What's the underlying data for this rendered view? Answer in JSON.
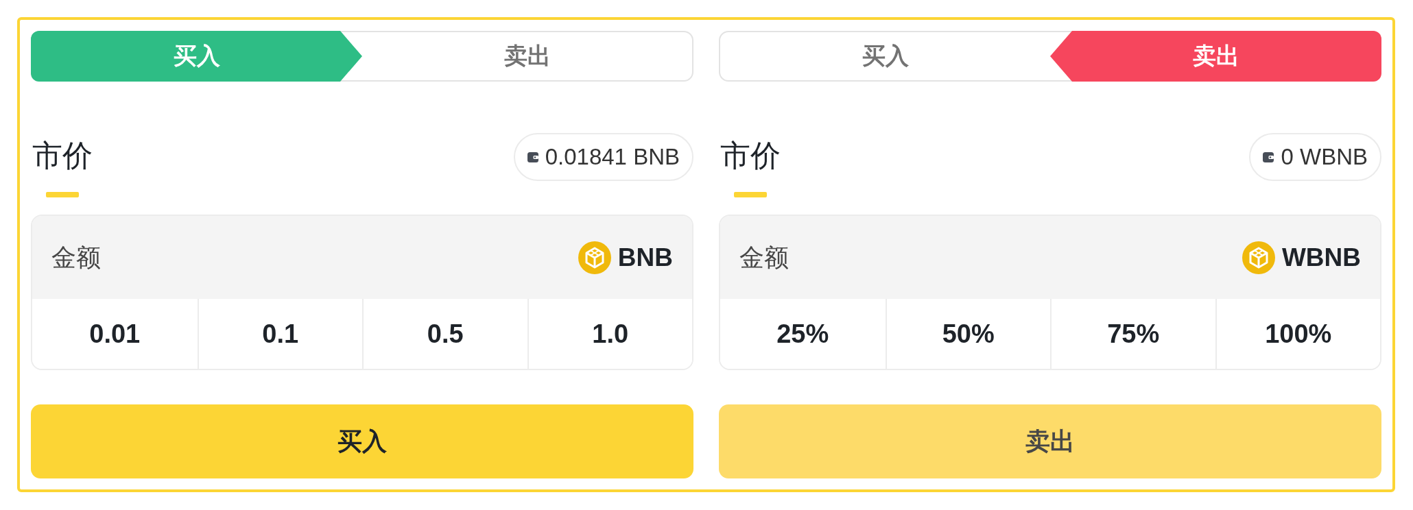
{
  "panels": [
    {
      "tabs": [
        {
          "label": "买入",
          "selected": true
        },
        {
          "label": "卖出",
          "selected": false
        }
      ],
      "order_type": {
        "label": "市价",
        "selected": true
      },
      "balance": "0.01841 BNB",
      "amount": {
        "placeholder": "金额",
        "token": "BNB",
        "presets": [
          "0.01",
          "0.1",
          "0.5",
          "1.0"
        ]
      },
      "submit": {
        "label": "买入",
        "disabled": false
      }
    },
    {
      "tabs": [
        {
          "label": "买入",
          "selected": false
        },
        {
          "label": "卖出",
          "selected": true
        }
      ],
      "order_type": {
        "label": "市价",
        "selected": true
      },
      "balance": "0 WBNB",
      "amount": {
        "placeholder": "金额",
        "token": "WBNB",
        "presets": [
          "25%",
          "50%",
          "75%",
          "100%"
        ]
      },
      "submit": {
        "label": "卖出",
        "disabled": true
      }
    }
  ]
}
